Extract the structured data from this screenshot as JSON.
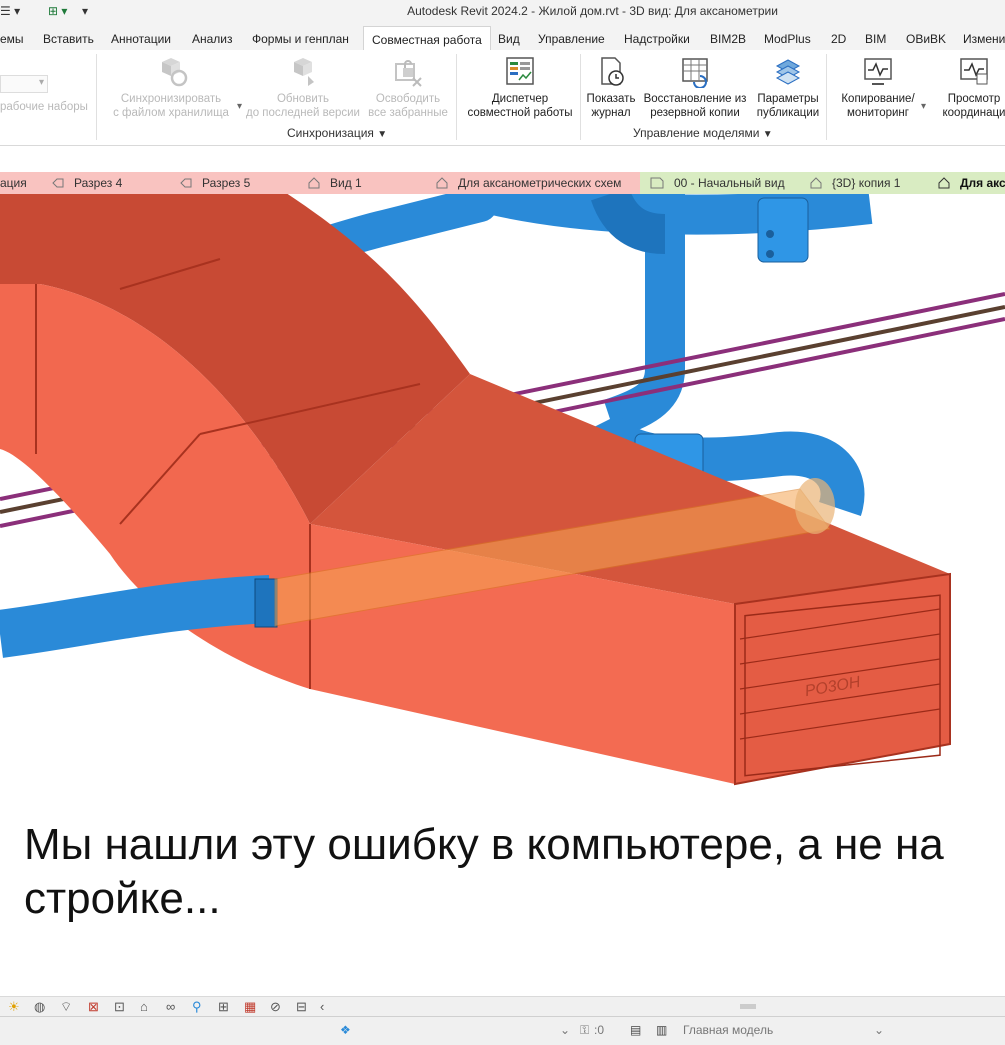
{
  "window": {
    "title": "Autodesk Revit 2024.2 - Жилой дом.rvt - 3D вид: Для аксанометрии"
  },
  "ribbon_tabs": [
    {
      "label": "емы"
    },
    {
      "label": "Вставить"
    },
    {
      "label": "Аннотации"
    },
    {
      "label": "Анализ"
    },
    {
      "label": "Формы и генплан"
    },
    {
      "label": "Совместная работа"
    },
    {
      "label": "Вид"
    },
    {
      "label": "Управление"
    },
    {
      "label": "Надстройки"
    },
    {
      "label": "BIM2B"
    },
    {
      "label": "ModPlus"
    },
    {
      "label": "2D"
    },
    {
      "label": "BIM"
    },
    {
      "label": "OBиBK"
    },
    {
      "label": "Измени"
    }
  ],
  "ribbon": {
    "worksets_label": "рабочие наборы",
    "sync_btn": {
      "line1": "Синхронизировать",
      "line2": "с файлом хранилища"
    },
    "reload_btn": {
      "line1": "Обновить",
      "line2": "до последней версии"
    },
    "relinquish_btn": {
      "line1": "Освободить",
      "line2": "все забранные"
    },
    "sync_panel": "Синхронизация",
    "dispatcher_btn": {
      "line1": "Диспетчер",
      "line2": "совместной работы"
    },
    "journal_btn": {
      "line1": "Показать",
      "line2": "журнал"
    },
    "restore_btn": {
      "line1": "Восстановление из",
      "line2": "резервной копии"
    },
    "publish_btn": {
      "line1": "Параметры",
      "line2": "публикации"
    },
    "models_panel": "Управление моделями",
    "copy_btn": {
      "line1": "Копирование/",
      "line2": "мониторинг"
    },
    "coord_btn": {
      "line1": "Просмотр",
      "line2": "координаци"
    }
  },
  "view_tabs": [
    {
      "label": "ация"
    },
    {
      "label": "Разрез 4"
    },
    {
      "label": "Разрез 5"
    },
    {
      "label": "Вид 1"
    },
    {
      "label": "Для аксанометрических схем"
    },
    {
      "label": "00 - Начальный вид"
    },
    {
      "label": "{3D} копия 1"
    },
    {
      "label": "Для акс"
    }
  ],
  "scene": {
    "grille_brand": "PO3OH"
  },
  "caption": "Мы нашли эту ошибку в компьютере, а не на стройке...",
  "statusbar": {
    "count": ":0",
    "model": "Главная модель"
  },
  "colors": {
    "duct": "#f2684f",
    "pipe": "#2a8ad8",
    "cable": "#8b2f7a",
    "active_tab": "#ffffff"
  }
}
